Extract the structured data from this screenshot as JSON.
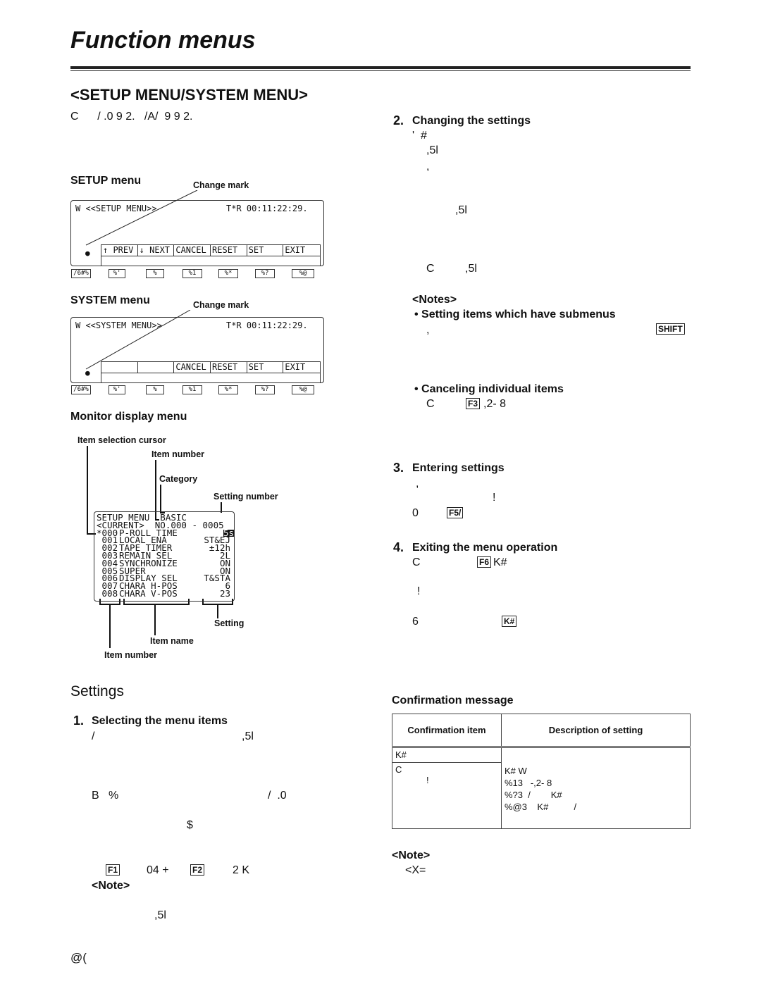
{
  "page": {
    "title": "Function menus",
    "section": "<SETUP MENU/SYSTEM MENU>",
    "intro": "C      / .0 9 2.   /A/  9 9 2.",
    "page_number": "@("
  },
  "setup_menu": {
    "heading": "SETUP menu",
    "change_mark_label": "Change mark",
    "screen_title": "W <<SETUP MENU>>",
    "timecode": "T*R 00:11:22:29.",
    "functions": [
      "↑ PREV",
      "↓ NEXT",
      "CANCEL",
      "RESET",
      "SET",
      "EXIT"
    ],
    "keys": [
      "/6#%",
      "%'",
      "%",
      "%1",
      "%*",
      "%?",
      "%@"
    ]
  },
  "system_menu": {
    "heading": "SYSTEM menu",
    "change_mark_label": "Change mark",
    "screen_title": "W <<SYSTEM MENU>>",
    "timecode": "T*R 00:11:22:29.",
    "functions": [
      "",
      "",
      "CANCEL",
      "RESET",
      "SET",
      "EXIT"
    ],
    "keys": [
      "/6#%",
      "%'",
      "%",
      "%1",
      "%*",
      "%?",
      "%@"
    ]
  },
  "monitor": {
    "heading": "Monitor display menu",
    "labels": {
      "cursor": "Item selection cursor",
      "item_number_top": "Item number",
      "category": "Category",
      "setting_number": "Setting number",
      "setting": "Setting",
      "item_name": "Item name",
      "item_number_bottom": "Item number"
    },
    "line1": "SETUP MENU  BASIC",
    "line2": "<CURRENT>  NO.000 - 0005",
    "rows": [
      {
        "num": "*000",
        "name": "P-ROLL TIME",
        "val": "5s"
      },
      {
        "num": " 001",
        "name": "LOCAL ENA",
        "val": "ST&EJ"
      },
      {
        "num": " 002",
        "name": "TAPE TIMER",
        "val": "±12h"
      },
      {
        "num": " 003",
        "name": "REMAIN SEL",
        "val": "2L"
      },
      {
        "num": " 004",
        "name": "SYNCHRONIZE",
        "val": "ON"
      },
      {
        "num": " 005",
        "name": "SUPER",
        "val": "ON"
      },
      {
        "num": " 006",
        "name": "DISPLAY SEL",
        "val": "T&STA"
      },
      {
        "num": " 007",
        "name": "CHARA H-POS",
        "val": "6"
      },
      {
        "num": " 008",
        "name": "CHARA V-POS",
        "val": "23"
      }
    ]
  },
  "settings": {
    "heading": "Settings",
    "step1": {
      "num": "1.",
      "title": "Selecting the menu items",
      "l1a": "/",
      "l1b": ",5l",
      "l2a": "B   %",
      "l2b": "/  .0",
      "l3": "$",
      "f1": "F1",
      "t1": "04 +",
      "f2": "F2",
      "t2": "2 K",
      "note": "<Note>",
      "note_text": ",5l"
    },
    "step2": {
      "num": "2.",
      "title": "Changing the settings",
      "l1": "'  #",
      "l2": ",5l",
      "l3": ",",
      "l4": ",5l",
      "l5a": "C",
      "l5b": ",5l",
      "notes": "<Notes>",
      "b1": "Setting items which have submenus",
      "b1_text": ",",
      "shift": "SHIFT",
      "b2": "Canceling individual items",
      "b2a": "C",
      "f3": "F3",
      "b2b": ",2- 8"
    },
    "step3": {
      "num": "3.",
      "title": "Entering settings",
      "l1": ",",
      "l2": "!",
      "l3a": "0",
      "f5": "F5/"
    },
    "step4": {
      "num": "4.",
      "title": "Exiting the menu operation",
      "l1a": "C",
      "f6": "F6",
      "l1b": "K#",
      "l2": "!",
      "l3a": "6",
      "k3": "K#"
    }
  },
  "confirmation": {
    "heading": "Confirmation message",
    "col1": "Confirmation item",
    "col2": "Description of setting",
    "r1": "K#",
    "r2a": "C",
    "r2b": "!",
    "desc": [
      "K# W",
      "%13   -,2- 8",
      "%?3  /        K#",
      "%@3    K#          /"
    ],
    "note": "<Note>",
    "note_text": "<X="
  }
}
